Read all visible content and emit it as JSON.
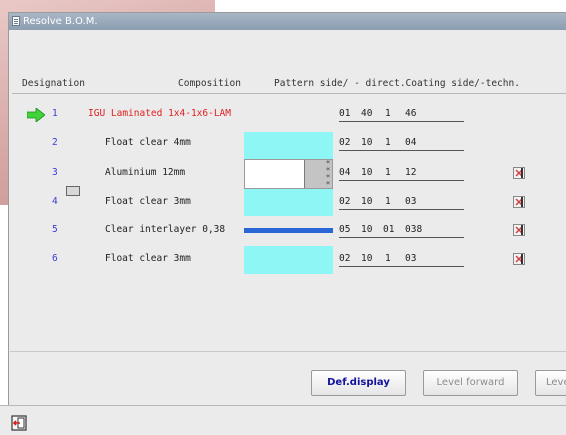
{
  "window": {
    "title": "Resolve B.O.M."
  },
  "headers": {
    "designation": "Designation",
    "composition": "Composition",
    "pattern": "Pattern side/ - direct.Coating side/-techn."
  },
  "rows": [
    {
      "num": "1",
      "name": "IGU Laminated 1x4-1x6-LAM",
      "codes": [
        "01",
        "40",
        "1",
        "46"
      ],
      "selected": true,
      "name_color": "#e02020",
      "edit": false
    },
    {
      "num": "2",
      "name": "Float clear 4mm",
      "codes": [
        "02",
        "10",
        "1",
        "04"
      ],
      "fill": "cyan",
      "edit": false
    },
    {
      "num": "3",
      "name": "Aluminium 12mm",
      "codes": [
        "04",
        "10",
        "1",
        "12"
      ],
      "fill": "spacer",
      "edit": true
    },
    {
      "num": "4",
      "name": "Float clear 3mm",
      "codes": [
        "02",
        "10",
        "1",
        "03"
      ],
      "fill": "cyan",
      "edit": true
    },
    {
      "num": "5",
      "name": "Clear interlayer 0,38",
      "codes": [
        "05",
        "10",
        "01",
        "038"
      ],
      "fill": "blue-line",
      "edit": true
    },
    {
      "num": "6",
      "name": "Float clear 3mm",
      "codes": [
        "02",
        "10",
        "1",
        "03"
      ],
      "fill": "cyan",
      "edit": true
    }
  ],
  "buttons": {
    "def_display": "Def.display",
    "level_forward": "Level forward",
    "level_back": "Leve"
  },
  "icons": {
    "arrow": "green-arrow-icon",
    "edit": "edit-icon",
    "exit": "exit-icon",
    "doc": "document-icon"
  },
  "colors": {
    "cyan": "#8ff6f6",
    "blue_line": "#2a66d6",
    "arrow_green": "#3fd43a",
    "row_num": "#3a3ad8",
    "highlight": "#e02020",
    "primary_btn_text": "#12129e"
  }
}
